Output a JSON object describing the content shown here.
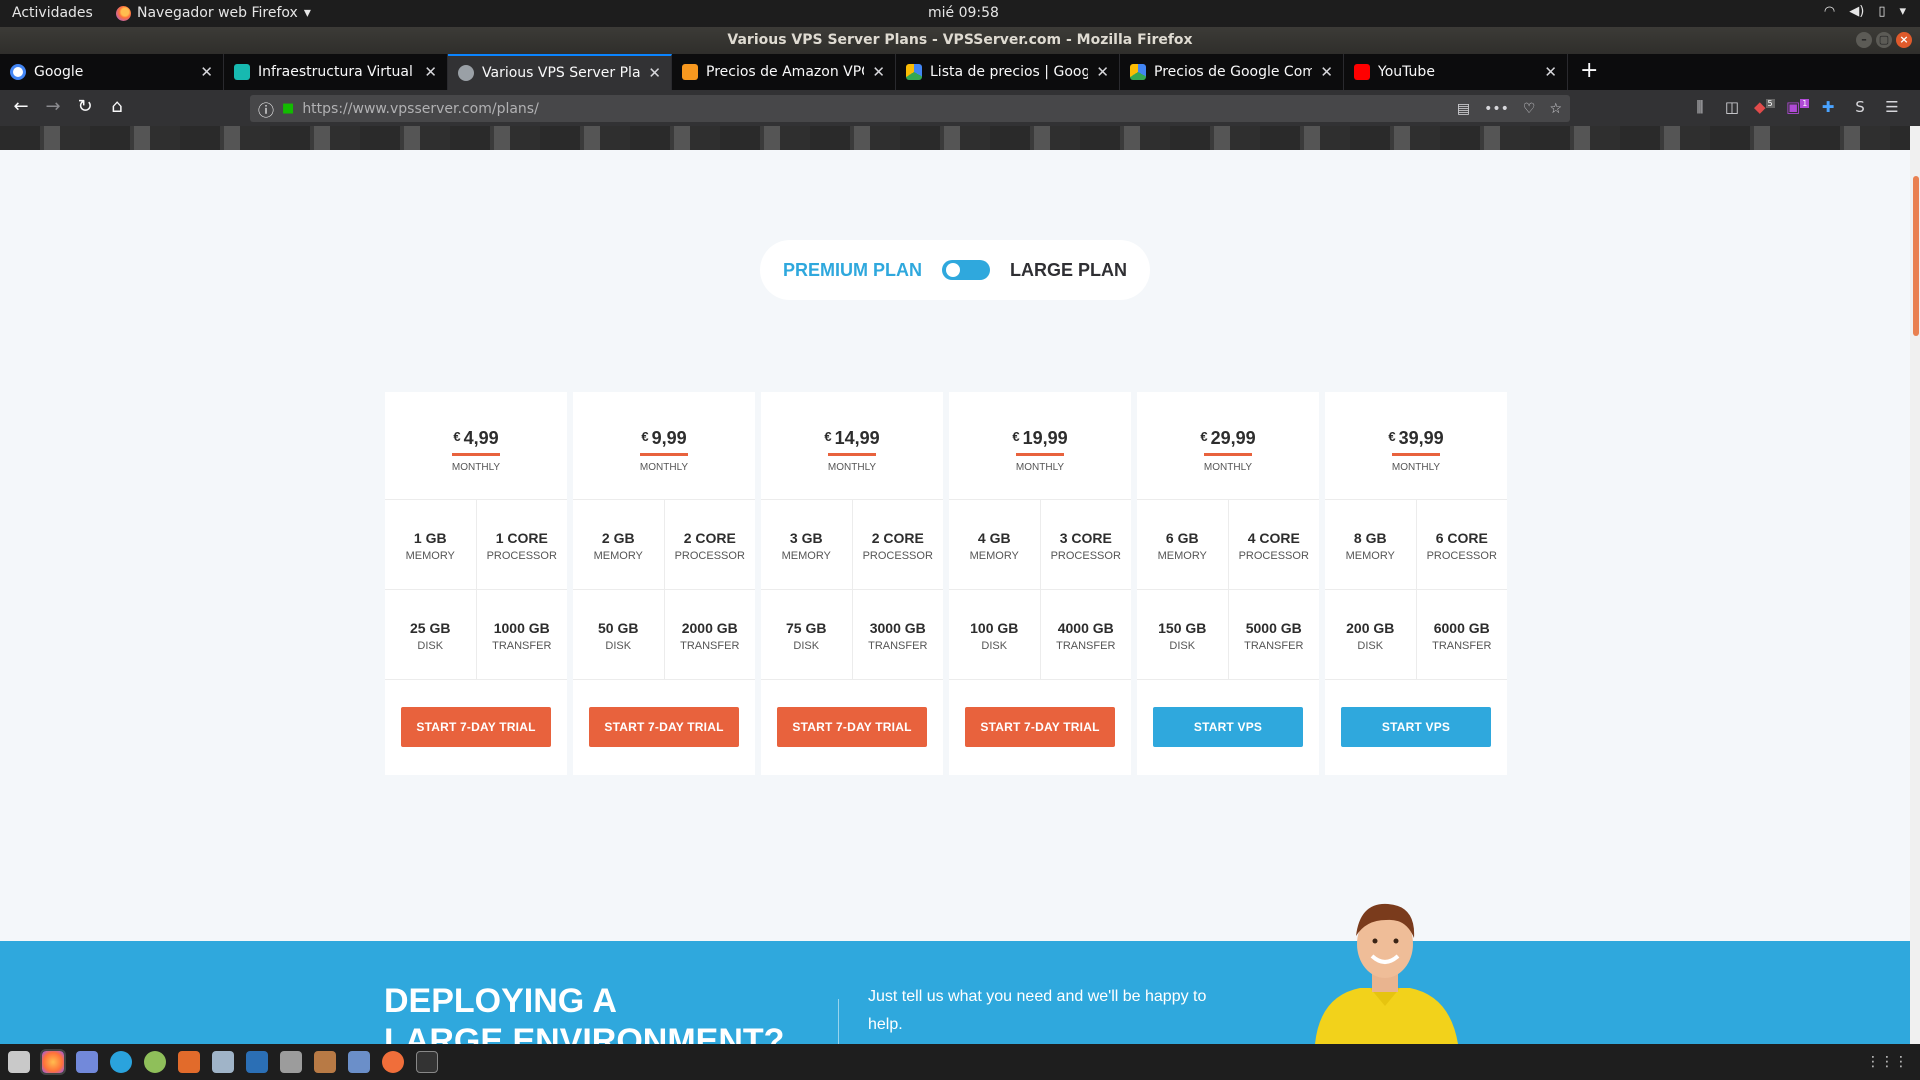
{
  "system": {
    "activities": "Actividades",
    "app_name": "Navegador web Firefox",
    "clock": "mié 09:58"
  },
  "window": {
    "title": "Various VPS Server Plans - VPSServer.com - Mozilla Firefox"
  },
  "tabs": [
    {
      "title": "Google",
      "favicon_color": "#4285f4"
    },
    {
      "title": "Infraestructura Virtual b",
      "favicon_color": "#17b9b0"
    },
    {
      "title": "Various VPS Server Plans",
      "favicon_color": "#9aa0a6"
    },
    {
      "title": "Precios de Amazon VPC",
      "favicon_color": "#f7981f"
    },
    {
      "title": "Lista de precios  |  Googl",
      "favicon_color": "#4285f4"
    },
    {
      "title": "Precios de Google Comp",
      "favicon_color": "#4285f4"
    },
    {
      "title": "YouTube",
      "favicon_color": "#ff0000"
    }
  ],
  "navbar": {
    "url": "https://www.vpsserver.com/plans/"
  },
  "toggle": {
    "premium_label": "PREMIUM PLAN",
    "large_label": "LARGE PLAN"
  },
  "plans": [
    {
      "currency": "€",
      "price": "4,99",
      "period": "MONTHLY",
      "memory": "1 GB",
      "memory_label": "MEMORY",
      "cpu": "1 CORE",
      "cpu_label": "PROCESSOR",
      "disk": "25 GB",
      "disk_label": "DISK",
      "transfer": "1000 GB",
      "transfer_label": "TRANSFER",
      "button": "START 7-DAY TRIAL",
      "button_color": "orange"
    },
    {
      "currency": "€",
      "price": "9,99",
      "period": "MONTHLY",
      "memory": "2 GB",
      "memory_label": "MEMORY",
      "cpu": "2 CORE",
      "cpu_label": "PROCESSOR",
      "disk": "50 GB",
      "disk_label": "DISK",
      "transfer": "2000 GB",
      "transfer_label": "TRANSFER",
      "button": "START 7-DAY TRIAL",
      "button_color": "orange"
    },
    {
      "currency": "€",
      "price": "14,99",
      "period": "MONTHLY",
      "memory": "3 GB",
      "memory_label": "MEMORY",
      "cpu": "2 CORE",
      "cpu_label": "PROCESSOR",
      "disk": "75 GB",
      "disk_label": "DISK",
      "transfer": "3000 GB",
      "transfer_label": "TRANSFER",
      "button": "START 7-DAY TRIAL",
      "button_color": "orange"
    },
    {
      "currency": "€",
      "price": "19,99",
      "period": "MONTHLY",
      "memory": "4 GB",
      "memory_label": "MEMORY",
      "cpu": "3 CORE",
      "cpu_label": "PROCESSOR",
      "disk": "100 GB",
      "disk_label": "DISK",
      "transfer": "4000 GB",
      "transfer_label": "TRANSFER",
      "button": "START 7-DAY TRIAL",
      "button_color": "orange"
    },
    {
      "currency": "€",
      "price": "29,99",
      "period": "MONTHLY",
      "memory": "6 GB",
      "memory_label": "MEMORY",
      "cpu": "4 CORE",
      "cpu_label": "PROCESSOR",
      "disk": "150 GB",
      "disk_label": "DISK",
      "transfer": "5000 GB",
      "transfer_label": "TRANSFER",
      "button": "START VPS",
      "button_color": "blue"
    },
    {
      "currency": "€",
      "price": "39,99",
      "period": "MONTHLY",
      "memory": "8 GB",
      "memory_label": "MEMORY",
      "cpu": "6 CORE",
      "cpu_label": "PROCESSOR",
      "disk": "200 GB",
      "disk_label": "DISK",
      "transfer": "6000 GB",
      "transfer_label": "TRANSFER",
      "button": "START VPS",
      "button_color": "blue"
    }
  ],
  "section": {
    "heading_line1": "DEPLOYING A",
    "heading_line2": "LARGE ENVIRONMENT?",
    "tell_text": "Just tell us what you need and we'll be happy to help."
  },
  "badges": {
    "ublock": "5",
    "container": "1"
  },
  "colors": {
    "accent_orange": "#e8623d",
    "accent_blue": "#2fa8dd"
  }
}
